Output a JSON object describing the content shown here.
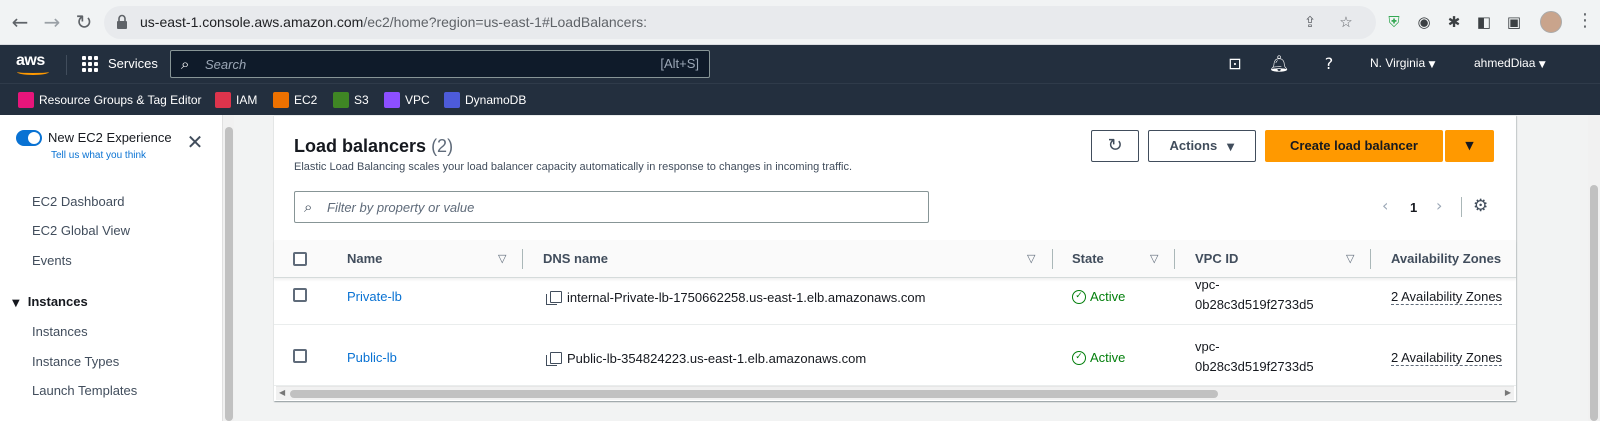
{
  "browser": {
    "url_host": "us-east-1.console.aws.amazon.com",
    "url_path": "/ec2/home?region=us-east-1#LoadBalancers:"
  },
  "aws_nav": {
    "logo": "aws",
    "services_label": "Services",
    "search_placeholder": "Search",
    "search_shortcut": "[Alt+S]",
    "region": "N. Virginia",
    "user": "ahmedDiaa"
  },
  "favorites": [
    {
      "label": "Resource Groups & Tag Editor",
      "color": "#e7157b"
    },
    {
      "label": "IAM",
      "color": "#dd344c"
    },
    {
      "label": "EC2",
      "color": "#ed7100"
    },
    {
      "label": "S3",
      "color": "#3f8624"
    },
    {
      "label": "VPC",
      "color": "#8c4fff"
    },
    {
      "label": "DynamoDB",
      "color": "#4d5bd9"
    }
  ],
  "sidebar": {
    "experience_title": "New EC2 Experience",
    "experience_link": "Tell us what you think",
    "items": [
      "EC2 Dashboard",
      "EC2 Global View",
      "Events"
    ],
    "section": "Instances",
    "section_items": [
      "Instances",
      "Instance Types",
      "Launch Templates"
    ]
  },
  "panel": {
    "title": "Load balancers",
    "count": "(2)",
    "description": "Elastic Load Balancing scales your load balancer capacity automatically in response to changes in incoming traffic.",
    "actions_label": "Actions",
    "create_label": "Create load balancer",
    "filter_placeholder": "Filter by property or value",
    "page_number": "1"
  },
  "table": {
    "columns": [
      "Name",
      "DNS name",
      "State",
      "VPC ID",
      "Availability Zones"
    ],
    "rows": [
      {
        "name": "Private-lb",
        "dns": "internal-Private-lb-1750662258.us-east-1.elb.amazonaws.com",
        "state": "Active",
        "vpc_line1": "vpc-",
        "vpc_line2": "0b28c3d519f2733d5",
        "az": "2 Availability Zones"
      },
      {
        "name": "Public-lb",
        "dns": "Public-lb-354824223.us-east-1.elb.amazonaws.com",
        "state": "Active",
        "vpc_line1": "vpc-",
        "vpc_line2": "0b28c3d519f2733d5",
        "az": "2 Availability Zones"
      }
    ]
  },
  "colors": {
    "aws_nav_bg": "#232f3e",
    "primary_button": "#ff9900",
    "link": "#0972d3",
    "status_active": "#037f0c"
  }
}
